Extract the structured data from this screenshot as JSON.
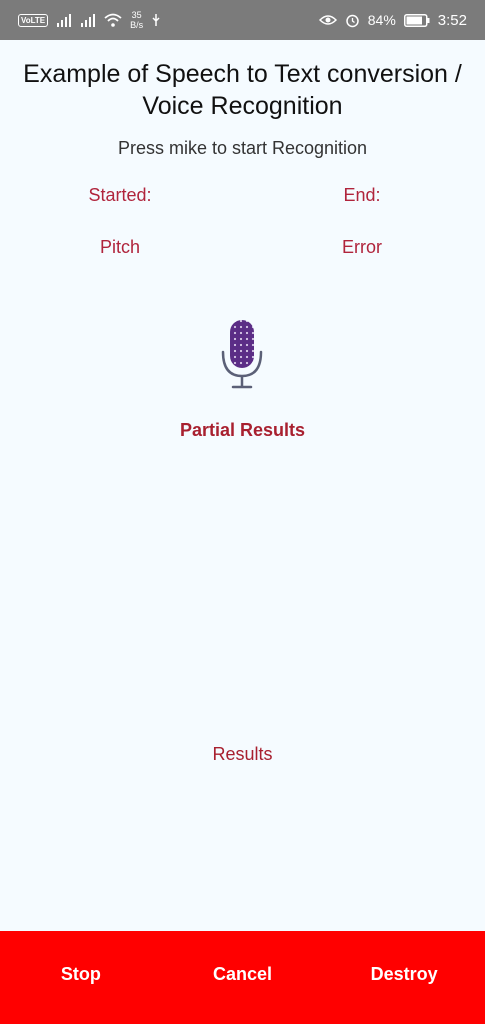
{
  "status_bar": {
    "volte": "VoLTE",
    "net_speed_value": "35",
    "net_speed_unit": "B/s",
    "battery_percent": "84%",
    "time": "3:52",
    "icons": [
      "volte-icon",
      "signal-icon",
      "signal-icon",
      "wifi-icon",
      "usb-icon",
      "eye-icon",
      "alarm-icon",
      "battery-icon"
    ]
  },
  "header": {
    "title": "Example of Speech to Text conversion / Voice Recognition",
    "subtitle": "Press mike to start Recognition"
  },
  "metrics": {
    "started": "Started:",
    "end": "End:",
    "pitch": "Pitch",
    "error": "Error"
  },
  "mic": {
    "icon": "microphone-icon",
    "color": "#5b2d86"
  },
  "partial_results_label": "Partial Results",
  "results_label": "Results",
  "bottom_bar": {
    "color": "#ff0000",
    "stop": "Stop",
    "cancel": "Cancel",
    "destroy": "Destroy"
  }
}
